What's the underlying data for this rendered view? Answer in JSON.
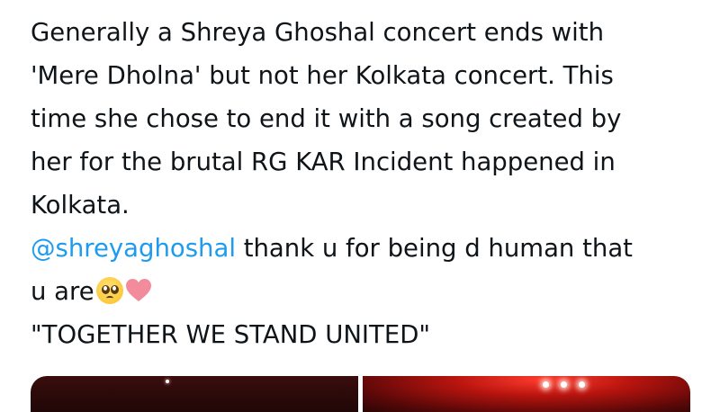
{
  "tweet": {
    "line1": "Generally a Shreya Ghoshal concert ends with",
    "line2": "'Mere Dholna' but not her Kolkata concert. This",
    "line3": "time she chose to end it with a song created by",
    "line4": "her for the brutal RG KAR Incident happened in",
    "line5": "Kolkata.",
    "mention": "@shreyaghoshal",
    "mention_rest": " thank u for being d human that",
    "line7": "u are",
    "emojis": [
      "pleading-face",
      "pink-heart"
    ],
    "quote": "\"TOGETHER WE STAND UNITED\"",
    "colors": {
      "text": "#0f1419",
      "mention": "#1d9bf0",
      "heart": "#f28b9b"
    }
  }
}
